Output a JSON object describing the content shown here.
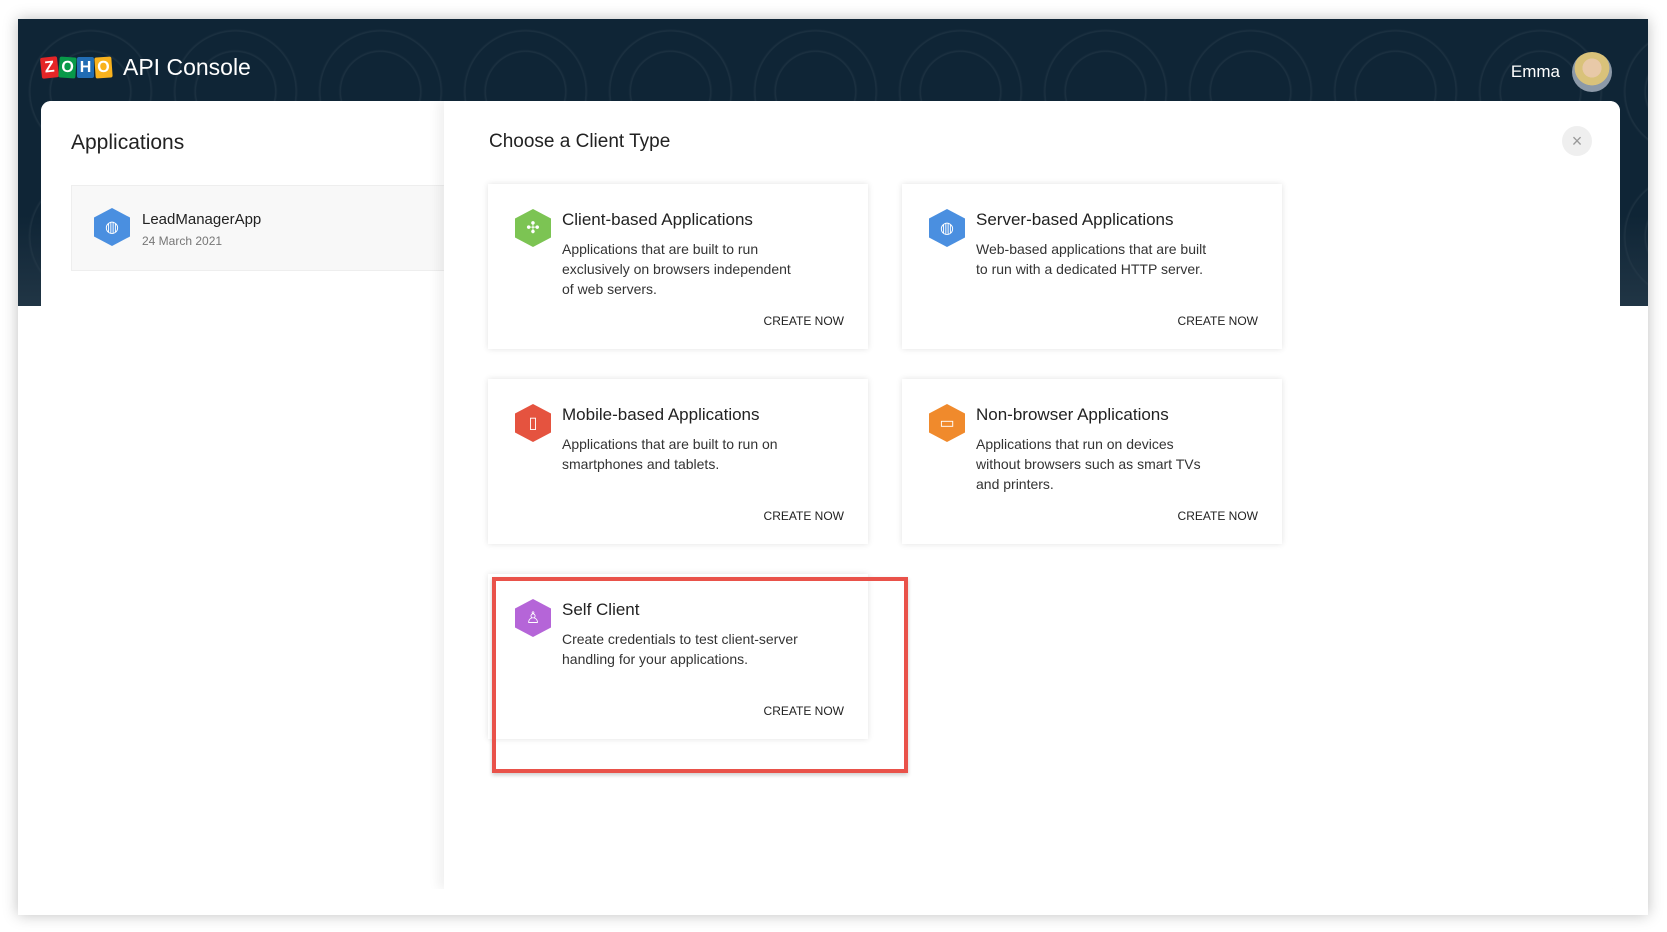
{
  "header": {
    "logo_letters": [
      "Z",
      "O",
      "H",
      "O"
    ],
    "logo_colors": [
      "#e42527",
      "#089949",
      "#226db4",
      "#f9b21d"
    ],
    "title": "API Console",
    "user_name": "Emma"
  },
  "sidebar": {
    "title": "Applications",
    "apps": [
      {
        "name": "LeadManagerApp",
        "date": "24 March 2021",
        "icon": "globe-icon"
      }
    ]
  },
  "main": {
    "title": "Choose a Client Type",
    "close_icon": "×",
    "client_types": [
      {
        "title": "Client-based Applications",
        "description": "Applications that are built to run exclusively on browsers independent of web servers.",
        "action": "CREATE NOW",
        "icon": "puzzle-icon",
        "color": "#7cc453"
      },
      {
        "title": "Server-based Applications",
        "description": "Web-based applications that are built to run with a dedicated HTTP server.",
        "action": "CREATE NOW",
        "icon": "globe-icon",
        "color": "#4a8fe0"
      },
      {
        "title": "Mobile-based Applications",
        "description": "Applications that are built to run on smartphones and tablets.",
        "action": "CREATE NOW",
        "icon": "mobile-icon",
        "color": "#e5533f"
      },
      {
        "title": "Non-browser Applications",
        "description": "Applications that run on devices without browsers such as smart TVs and printers.",
        "action": "CREATE NOW",
        "icon": "tv-icon",
        "color": "#f08a2c"
      },
      {
        "title": "Self Client",
        "description": "Create credentials to test client-server handling for your applications.",
        "action": "CREATE NOW",
        "icon": "user-icon",
        "color": "#b565d8"
      }
    ]
  }
}
